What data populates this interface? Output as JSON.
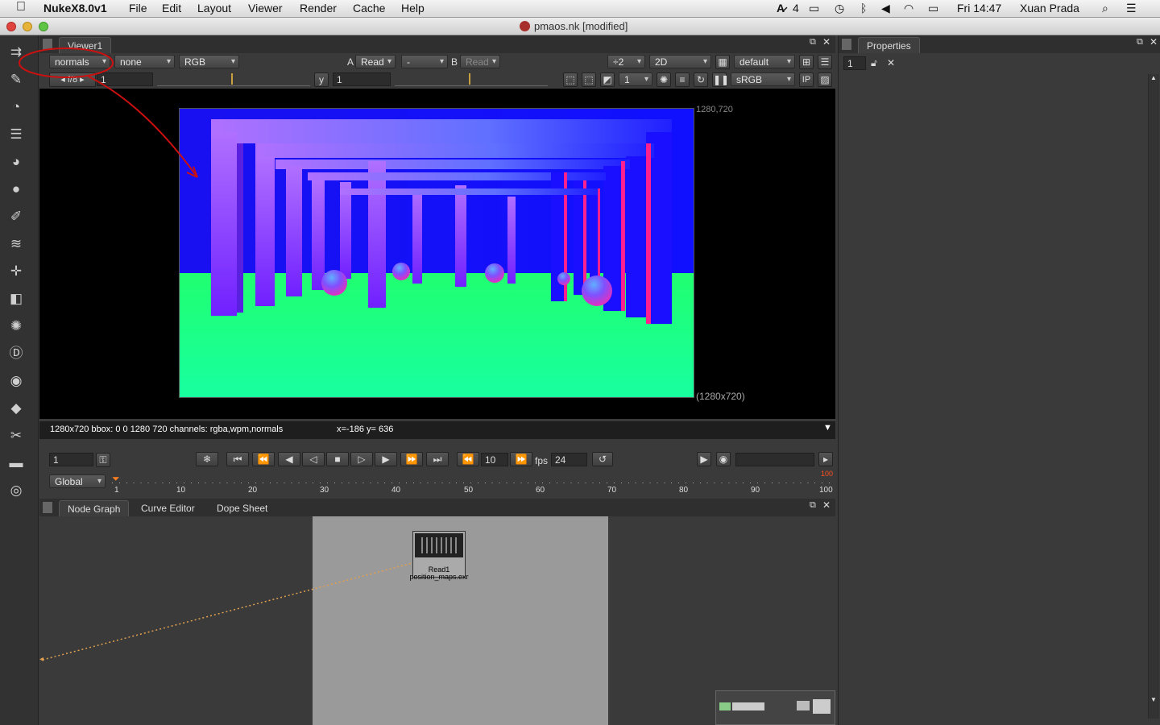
{
  "menubar": {
    "app": "NukeX8.0v1",
    "items": [
      "File",
      "Edit",
      "Layout",
      "Viewer",
      "Render",
      "Cache",
      "Help"
    ],
    "status": {
      "adobe": "4",
      "time": "Fri 14:47",
      "user": "Xuan Prada"
    }
  },
  "window": {
    "title": "pmaos.nk [modified]"
  },
  "viewer": {
    "tab": "Viewer1",
    "channel_set": "normals",
    "channel_alpha": "none",
    "display_channels": "RGB",
    "a_label": "A",
    "a_input": "Read",
    "op": "-",
    "b_label": "B",
    "b_input": "Read",
    "downscale": "÷2",
    "view_mode": "2D",
    "lut_default": "default",
    "fstop_label": "f/8",
    "gain": "1",
    "gamma_label": "y",
    "gamma": "1",
    "proxy_value": "1",
    "colorspace": "sRGB",
    "ip_label": "IP",
    "format_top": "1280,720",
    "format_bottom": "(1280x720)",
    "info": "1280x720 bbox: 0 0 1280 720 channels: rgba,wpm,normals",
    "cursor": "x=-186 y= 636"
  },
  "timeline": {
    "frame_field": "1",
    "current_frame": "10",
    "fps_label": "fps",
    "fps": "24",
    "range_mode": "Global",
    "end_frame_marker": "100",
    "ticks": [
      "1",
      "10",
      "20",
      "30",
      "40",
      "50",
      "60",
      "70",
      "80",
      "90",
      "100"
    ]
  },
  "properties": {
    "tab": "Properties",
    "max_panels": "1"
  },
  "nodegraph": {
    "tabs": [
      "Node Graph",
      "Curve Editor",
      "Dope Sheet"
    ],
    "node": {
      "name": "Read1",
      "file": "position_maps.exr"
    }
  },
  "colors": {
    "annotation_red": "#cc1010",
    "sky_blue": "#1a10f5",
    "ground_green": "#20ff80",
    "pillar_purple": "#a050ff"
  }
}
